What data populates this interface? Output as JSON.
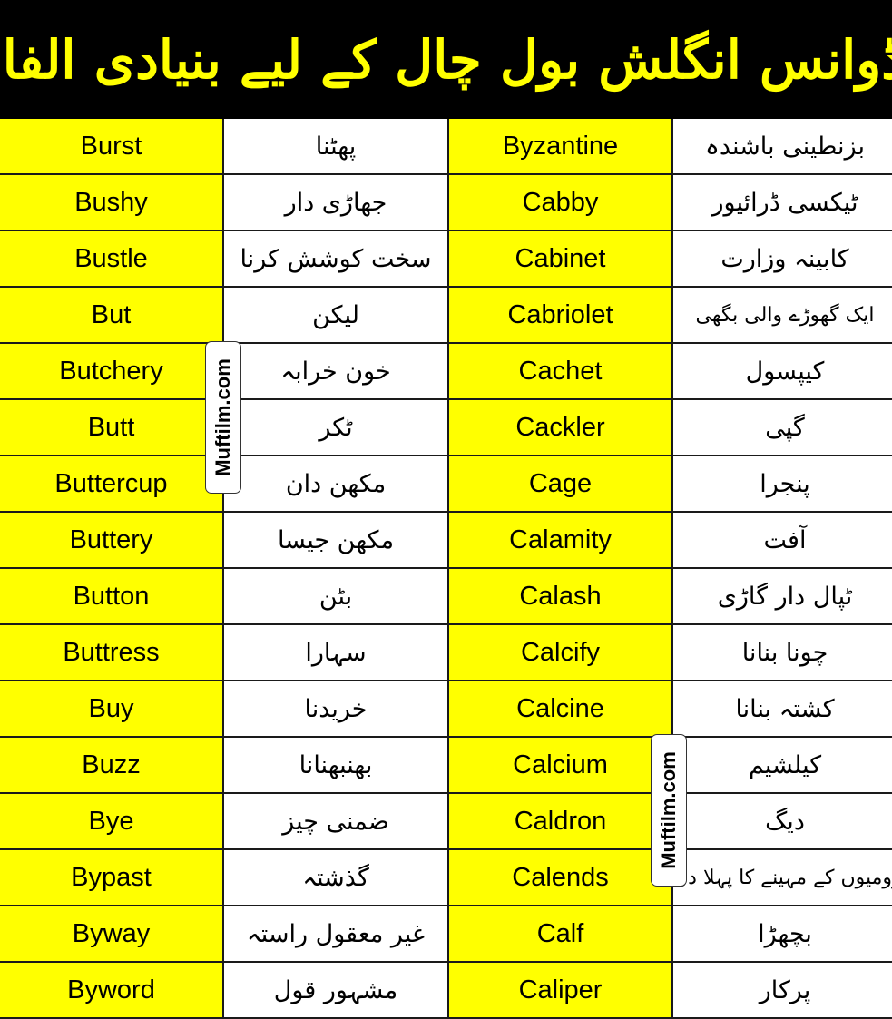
{
  "header": {
    "title": "ایڈوانس انگلش بول چال کے لیے بنیادی الفاظ"
  },
  "colors": {
    "header_bg": "#000000",
    "header_text": "#ffff00",
    "english_cell_bg": "#ffff00",
    "urdu_cell_bg": "#ffffff",
    "border": "#1a1a1a"
  },
  "watermark": "Muftilm.com",
  "rows": [
    {
      "left_en": "Burst",
      "left_ur": "پھٹنا",
      "right_en": "Byzantine",
      "right_ur": "بزنطینی باشندہ"
    },
    {
      "left_en": "Bushy",
      "left_ur": "جھاڑی دار",
      "right_en": "Cabby",
      "right_ur": "ٹیکسی ڈرائیور"
    },
    {
      "left_en": "Bustle",
      "left_ur": "سخت کوشش کرنا",
      "right_en": "Cabinet",
      "right_ur": "کابینہ وزارت"
    },
    {
      "left_en": "But",
      "left_ur": "لیکن",
      "right_en": "Cabriolet",
      "right_ur": "ایک گھوڑے والی بگھی"
    },
    {
      "left_en": "Butchery",
      "left_ur": "خون خرابہ",
      "right_en": "Cachet",
      "right_ur": "کیپسول"
    },
    {
      "left_en": "Butt",
      "left_ur": "ٹکر",
      "right_en": "Cackler",
      "right_ur": "گپی"
    },
    {
      "left_en": "Buttercup",
      "left_ur": "مکھن دان",
      "right_en": "Cage",
      "right_ur": "پنجرا"
    },
    {
      "left_en": "Buttery",
      "left_ur": "مکھن جیسا",
      "right_en": "Calamity",
      "right_ur": "آفت"
    },
    {
      "left_en": "Button",
      "left_ur": "بٹن",
      "right_en": "Calash",
      "right_ur": "ٹپال دار گاڑی"
    },
    {
      "left_en": "Buttress",
      "left_ur": "سہارا",
      "right_en": "Calcify",
      "right_ur": "چونا بنانا"
    },
    {
      "left_en": "Buy",
      "left_ur": "خریدنا",
      "right_en": "Calcine",
      "right_ur": "کشتہ بنانا"
    },
    {
      "left_en": "Buzz",
      "left_ur": "بھنبھنانا",
      "right_en": "Calcium",
      "right_ur": "کیلشیم"
    },
    {
      "left_en": "Bye",
      "left_ur": "ضمنی چیز",
      "right_en": "Caldron",
      "right_ur": "دیگ"
    },
    {
      "left_en": "Bypast",
      "left_ur": "گذشتہ",
      "right_en": "Calends",
      "right_ur": "رومیوں کے مہینے کا پہلا دن"
    },
    {
      "left_en": "Byway",
      "left_ur": "غیر معقول راستہ",
      "right_en": "Calf",
      "right_ur": "بچھڑا"
    },
    {
      "left_en": "Byword",
      "left_ur": "مشہور قول",
      "right_en": "Caliper",
      "right_ur": "پرکار"
    }
  ]
}
